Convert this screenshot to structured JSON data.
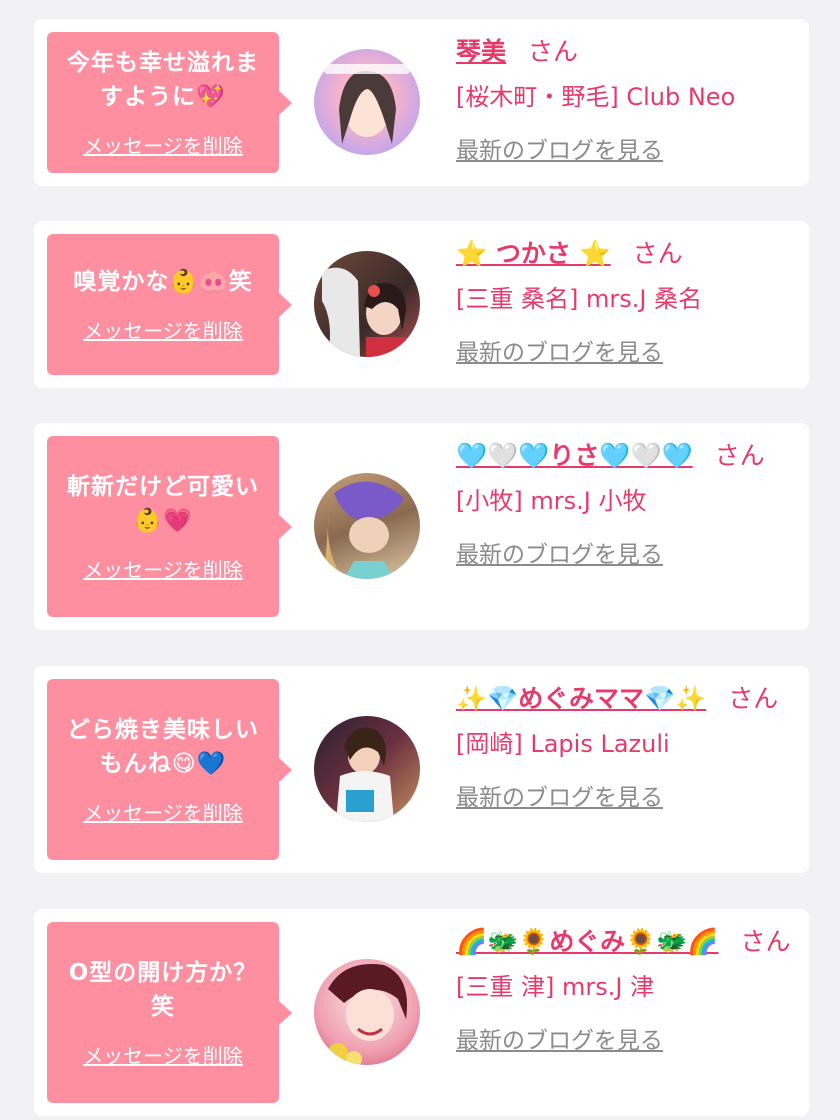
{
  "colors": {
    "bubble": "#fe8fa1",
    "accent": "#e8396b",
    "link_gray": "#8b8b8b",
    "background": "#f2f2f4"
  },
  "cards": [
    {
      "message_line1": "今年も幸せ溢れま",
      "message_line2": "すように💖",
      "delete_label": "メッセージを削除",
      "name": "琴美",
      "san": "さん",
      "shop": "[桜木町・野毛] Club Neo",
      "blog_label": "最新のブログを見る"
    },
    {
      "message_line1": "嗅覚かな👶🐽笑",
      "message_line2": "",
      "delete_label": "メッセージを削除",
      "name": "⭐️ つかさ ⭐️",
      "san": "さん",
      "shop": "[三重 桑名] mrs.J 桑名",
      "blog_label": "最新のブログを見る"
    },
    {
      "message_line1": "斬新だけど可愛い",
      "message_line2": "👶💗",
      "delete_label": "メッセージを削除",
      "name": "🩵🤍🩵りさ🩵🤍🩵",
      "san": "さん",
      "shop": "[小牧] mrs.J 小牧",
      "blog_label": "最新のブログを見る"
    },
    {
      "message_line1": "どら焼き美味しい",
      "message_line2": "もんね😋💙",
      "delete_label": "メッセージを削除",
      "name": "✨💎めぐみママ💎✨",
      "san": "さん",
      "shop": "[岡崎] Lapis Lazuli",
      "blog_label": "最新のブログを見る"
    },
    {
      "message_line1": "O型の開け方か？",
      "message_line2": "笑",
      "delete_label": "メッセージを削除",
      "name": "🌈🐲🌻めぐみ🌻🐲🌈",
      "san": "さん",
      "shop": "[三重 津] mrs.J 津",
      "blog_label": "最新のブログを見る"
    }
  ]
}
